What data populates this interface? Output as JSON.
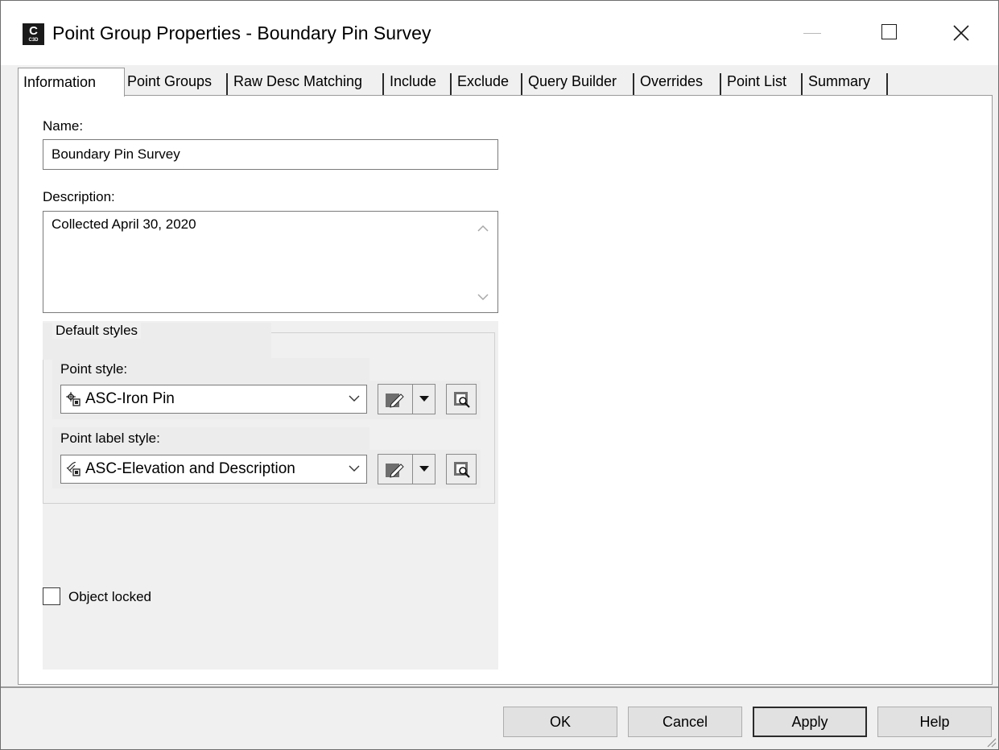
{
  "window": {
    "title": "Point Group Properties - Boundary Pin Survey",
    "app_icon_letter": "C",
    "app_icon_sub": "C3D"
  },
  "tabs": [
    {
      "label": "Information",
      "active": true
    },
    {
      "label": "Point Groups"
    },
    {
      "label": "Raw Desc Matching"
    },
    {
      "label": "Include"
    },
    {
      "label": "Exclude"
    },
    {
      "label": "Query Builder"
    },
    {
      "label": "Overrides"
    },
    {
      "label": "Point List"
    },
    {
      "label": "Summary"
    }
  ],
  "form": {
    "name_label": "Name:",
    "name_value": "Boundary Pin Survey",
    "description_label": "Description:",
    "description_value": "Collected April 30, 2020",
    "default_styles_label": "Default styles",
    "point_style_label": "Point style:",
    "point_style_value": "ASC-Iron Pin",
    "point_label_style_label": "Point label style:",
    "point_label_style_value": "ASC-Elevation and Description",
    "object_locked_label": "Object locked",
    "object_locked_checked": false
  },
  "buttons": {
    "ok": "OK",
    "cancel": "Cancel",
    "apply": "Apply",
    "help": "Help"
  },
  "icons": {
    "point_style": "point-style-icon",
    "label_style": "label-style-icon",
    "edit": "edit-style-icon",
    "browse": "browse-style-icon",
    "close": "close-icon",
    "minimize": "minimize-icon",
    "maximize": "maximize-icon"
  }
}
